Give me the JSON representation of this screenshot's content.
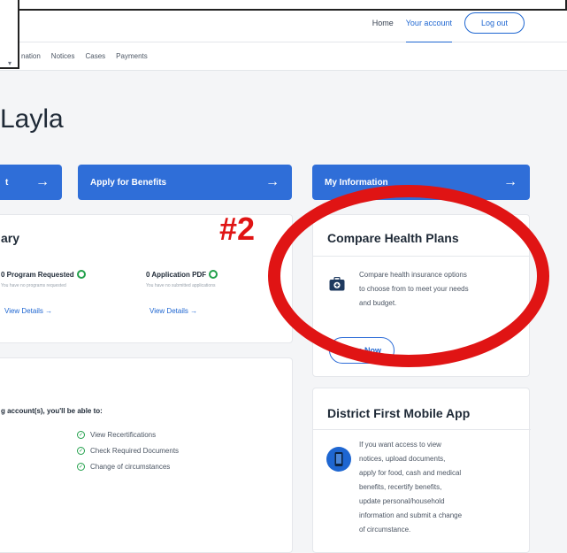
{
  "header": {
    "nav": [
      {
        "label": "Home",
        "active": false
      },
      {
        "label": "Your account",
        "active": true
      }
    ],
    "logout_label": "Log out"
  },
  "subnav": {
    "items": [
      "nation",
      "Notices",
      "Cases",
      "Payments"
    ]
  },
  "greeting": "Layla",
  "actions": [
    {
      "label": "t"
    },
    {
      "label": "Apply for Benefits"
    },
    {
      "label": "My Information"
    }
  ],
  "summary": {
    "title": "ary",
    "stats": [
      {
        "title": "0 Program Requested",
        "subtitle": "You have no programs requested",
        "link": "View Details →"
      },
      {
        "title": "0 Application PDF",
        "subtitle": "You have no submitted applications",
        "link": "View Details →"
      }
    ]
  },
  "linked": {
    "intro": "g account(s), you'll be able to:",
    "items": [
      "View Recertifications",
      "Check Required Documents",
      "Change of circumstances"
    ]
  },
  "compare": {
    "title": "Compare Health Plans",
    "lines": [
      "Compare health insurance options",
      "to choose from to meet your needs",
      "and budget."
    ],
    "button": "Shop Now"
  },
  "mobile": {
    "title": "District First Mobile App",
    "lines": [
      "If you want access to view",
      "notices, upload documents,",
      "apply for food, cash and medical",
      "benefits, recertify benefits,",
      "update personal/household",
      "information and submit a change",
      "of circumstance."
    ]
  },
  "annotation": {
    "label": "#2",
    "color": "#e01414"
  },
  "colors": {
    "primary": "#2f6ed8",
    "success": "#22a04b",
    "annotation": "#e01414"
  }
}
